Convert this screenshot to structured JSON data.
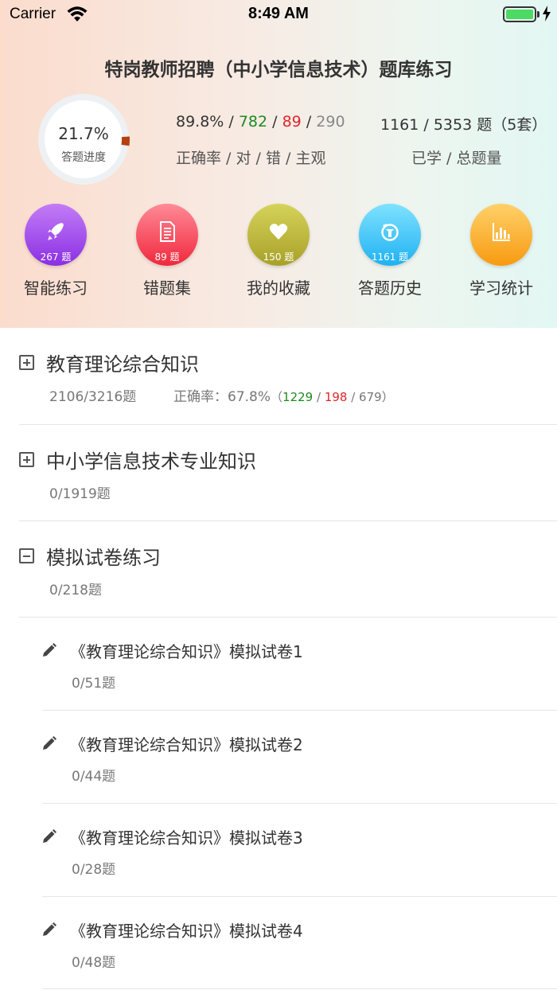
{
  "status_bar": {
    "carrier": "Carrier",
    "time": "8:49 AM"
  },
  "header": {
    "title": "特岗教师招聘（中小学信息技术）题库练习",
    "progress": {
      "percent_text": "21.7%",
      "label": "答题进度",
      "value": 0.217
    },
    "accuracy": {
      "rate": "89.8%",
      "sep1": " / ",
      "correct": "782",
      "sep2": " / ",
      "wrong": "89",
      "sep3": " / ",
      "subjective": "290",
      "caption": "正确率 / 对 / 错 / 主观"
    },
    "study": {
      "text": "1161 / 5353 题（5套）",
      "caption": "已学 / 总题量"
    },
    "colors": {
      "correct": "#1f8a1f",
      "wrong": "#e0262b",
      "progress_arc": "#b5410f"
    }
  },
  "functions": [
    {
      "label": "智能练习",
      "count": "267 题",
      "icon": "rocket-icon",
      "color_top": "#c37cf6",
      "color_bottom": "#8a2fe3"
    },
    {
      "label": "错题集",
      "count": "89 题",
      "icon": "document-icon",
      "color_top": "#ff8a96",
      "color_bottom": "#f0283d"
    },
    {
      "label": "我的收藏",
      "count": "150 题",
      "icon": "heart-icon",
      "color_top": "#d6d35a",
      "color_bottom": "#a8a128"
    },
    {
      "label": "答题历史",
      "count": "1161 题",
      "icon": "history-icon",
      "color_top": "#7fe2ff",
      "color_bottom": "#1fb1f2"
    },
    {
      "label": "学习统计",
      "count": "",
      "icon": "chart-icon",
      "color_top": "#ffd16a",
      "color_bottom": "#f79a10"
    }
  ],
  "categories": [
    {
      "title": "教育理论综合知识",
      "progress": "2106/3216题",
      "expanded": false,
      "accuracy_label": "正确率：",
      "accuracy": "67.8%",
      "open": "（",
      "correct": "1229",
      "s1": " / ",
      "wrong": "198",
      "s2": " / ",
      "subjective": "679",
      "close": "）"
    },
    {
      "title": "中小学信息技术专业知识",
      "progress": "0/1919题",
      "expanded": false
    },
    {
      "title": "模拟试卷练习",
      "progress": "0/218题",
      "expanded": true
    }
  ],
  "papers": [
    {
      "title": "《教育理论综合知识》模拟试卷1",
      "progress": "0/51题"
    },
    {
      "title": "《教育理论综合知识》模拟试卷2",
      "progress": "0/44题"
    },
    {
      "title": "《教育理论综合知识》模拟试卷3",
      "progress": "0/28题"
    },
    {
      "title": "《教育理论综合知识》模拟试卷4",
      "progress": "0/48题"
    }
  ]
}
